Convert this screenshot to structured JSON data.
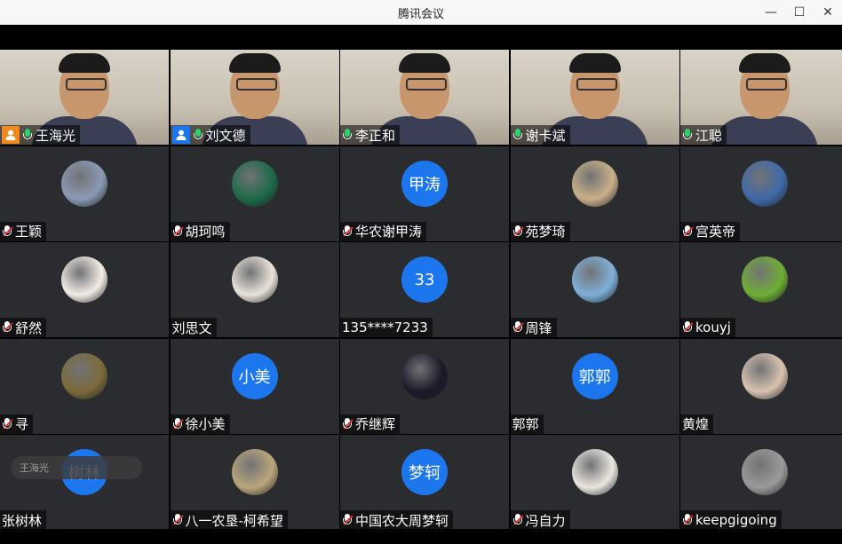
{
  "window": {
    "title": "腾讯会议",
    "minimize_glyph": "—",
    "maximize_glyph": "☐",
    "close_glyph": "✕"
  },
  "toast": {
    "text": "王海光"
  },
  "participants": [
    {
      "name": "王海光",
      "type": "video",
      "mic": "on",
      "badge": "orange"
    },
    {
      "name": "刘文德",
      "type": "video",
      "mic": "on",
      "badge": "blue",
      "active": true
    },
    {
      "name": "李正和",
      "type": "video",
      "mic": "on"
    },
    {
      "name": "谢卡斌",
      "type": "video",
      "mic": "on"
    },
    {
      "name": "江聪",
      "type": "video",
      "mic": "on"
    },
    {
      "name": "王颖",
      "type": "avatar",
      "mic": "off",
      "avatar_color": "#8a9ab4"
    },
    {
      "name": "胡珂鸣",
      "type": "avatar",
      "mic": "off",
      "avatar_color": "#1d6a4a"
    },
    {
      "name": "华农谢甲涛",
      "type": "initials",
      "initials": "甲涛",
      "mic": "off"
    },
    {
      "name": "苑梦琦",
      "type": "avatar",
      "mic": "off",
      "avatar_color": "#c9b08a"
    },
    {
      "name": "宫英帝",
      "type": "avatar",
      "mic": "off",
      "avatar_color": "#3f6aa8"
    },
    {
      "name": "舒然",
      "type": "avatar",
      "mic": "off",
      "avatar_color": "#f2ece6"
    },
    {
      "name": "刘思文",
      "type": "avatar",
      "mic": "none",
      "avatar_color": "#e9e2da"
    },
    {
      "name": "135****7233",
      "type": "initials",
      "initials": "33",
      "mic": "none"
    },
    {
      "name": "周锋",
      "type": "avatar",
      "mic": "off",
      "avatar_color": "#7fb0d8"
    },
    {
      "name": "kouyj",
      "type": "avatar",
      "mic": "off",
      "avatar_color": "#6fae34"
    },
    {
      "name": "寻",
      "type": "avatar",
      "mic": "off",
      "avatar_color": "#7b6a3a"
    },
    {
      "name": "徐小美",
      "type": "initials",
      "initials": "小美",
      "mic": "off"
    },
    {
      "name": "乔继辉",
      "type": "avatar",
      "mic": "off",
      "avatar_color": "#1a1a2a"
    },
    {
      "name": "郭郭",
      "type": "initials",
      "initials": "郭郭",
      "mic": "none"
    },
    {
      "name": "黄煌",
      "type": "avatar",
      "mic": "none",
      "avatar_color": "#d8c2b0"
    },
    {
      "name": "张树林",
      "type": "initials",
      "initials": "树林",
      "mic": "none"
    },
    {
      "name": "八一农垦-柯希望",
      "type": "avatar",
      "mic": "off",
      "avatar_color": "#b9a67a"
    },
    {
      "name": "中国农大周梦轲",
      "type": "initials",
      "initials": "梦轲",
      "mic": "off"
    },
    {
      "name": "冯自力",
      "type": "avatar",
      "mic": "off",
      "avatar_color": "#eae6e0"
    },
    {
      "name": "keepgigoing",
      "type": "avatar",
      "mic": "off",
      "avatar_color": "#9a9a9a"
    }
  ]
}
